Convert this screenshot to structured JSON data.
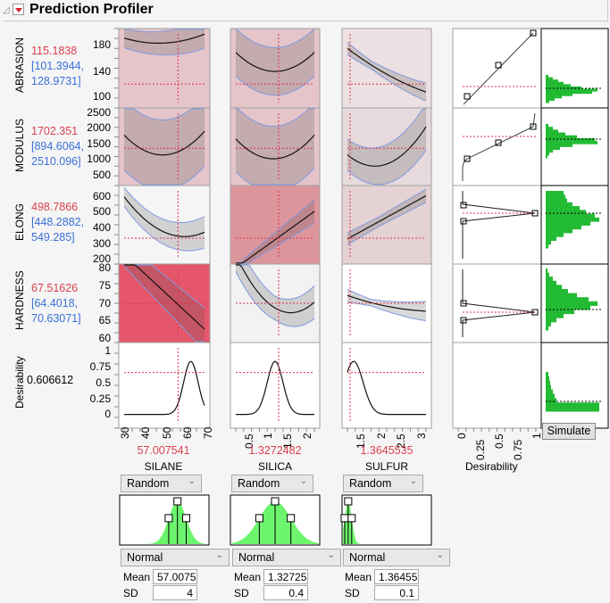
{
  "header": {
    "title": "Prediction Profiler"
  },
  "responses": [
    {
      "name": "ABRASION",
      "prediction": "115.1838",
      "ci_low": "[101.3944,",
      "ci_high": "128.9731]",
      "yticks": [
        "180",
        "140",
        "100"
      ]
    },
    {
      "name": "MODULUS",
      "prediction": "1702.351",
      "ci_low": "[894.6064,",
      "ci_high": "2510.096]",
      "yticks": [
        "2500",
        "2000",
        "1500",
        "1000",
        "500"
      ]
    },
    {
      "name": "ELONG",
      "prediction": "498.7866",
      "ci_low": "[448.2882,",
      "ci_high": "549.285]",
      "yticks": [
        "600",
        "500",
        "400",
        "300",
        "200"
      ]
    },
    {
      "name": "HARDNESS",
      "prediction": "67.51626",
      "ci_low": "[64.4018,",
      "ci_high": "70.63071]",
      "yticks": [
        "80",
        "75",
        "70",
        "65",
        "60"
      ]
    }
  ],
  "desirability": {
    "label": "Desirability",
    "value": "0.606612",
    "yticks": [
      "1",
      "0.75",
      "0.5",
      "0.25",
      "0"
    ],
    "xticks": [
      "0",
      "0.25",
      "0.5",
      "0.75",
      "1"
    ],
    "axis_label": "Desirability"
  },
  "factors": [
    {
      "name": "SILANE",
      "current": "57.007541",
      "xticks": [
        "30",
        "40",
        "50",
        "60",
        "70"
      ],
      "mode": "Random",
      "distribution": "Normal",
      "mean_label": "Mean",
      "mean": "57.0075",
      "sd_label": "SD",
      "sd": "4"
    },
    {
      "name": "SILICA",
      "current": "1.3272482",
      "xticks": [
        "0.5",
        "1",
        "1.5",
        "2"
      ],
      "mode": "Random",
      "distribution": "Normal",
      "mean_label": "Mean",
      "mean": "1.32725",
      "sd_label": "SD",
      "sd": "0.4"
    },
    {
      "name": "SULFUR",
      "current": "1.3645535",
      "xticks": [
        "1.5",
        "2",
        "2.5",
        "3"
      ],
      "mode": "Random",
      "distribution": "Normal",
      "mean_label": "Mean",
      "mean": "1.36455",
      "sd_label": "SD",
      "sd": "0.1"
    }
  ],
  "simulate": {
    "label": "Simulate"
  },
  "colors": {
    "prediction": "#d9404f",
    "ci": "#3a6fd8",
    "histogram": "#22bb33",
    "dist_fill": "#6cf56c"
  }
}
